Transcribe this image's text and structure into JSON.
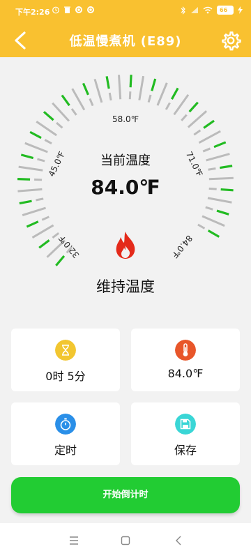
{
  "status": {
    "time": "下午2:26",
    "battery": "66",
    "icons": [
      "alarm-icon",
      "trash-icon",
      "sync-icon",
      "sync-icon"
    ]
  },
  "header": {
    "title": "低温慢煮机 (E89)",
    "back_icon": "chevron-left-icon",
    "settings_icon": "gear-icon",
    "background": "#f9c130"
  },
  "dial": {
    "scale_labels": [
      "32.0℉",
      "45.0℉",
      "58.0℉",
      "71.0℉",
      "84.0℉"
    ],
    "current_label": "当前温度",
    "current_value": "84.0℉",
    "mode_label": "维持温度",
    "active_color": "#22bb22",
    "inactive_color": "#bbbbbb"
  },
  "cards": {
    "timer": {
      "label": "0时 5分",
      "icon": "hourglass-icon",
      "color": "#f2c630"
    },
    "temperature": {
      "label": "84.0℉",
      "icon": "thermometer-icon",
      "color": "#e8562a"
    },
    "schedule": {
      "label": "定时",
      "icon": "stopwatch-icon",
      "color": "#2a8fe8"
    },
    "save": {
      "label": "保存",
      "icon": "floppy-disk-icon",
      "color": "#3ad6d6"
    }
  },
  "start_button": {
    "label": "开始倒计时",
    "color": "#22cc33"
  },
  "navbar": {
    "icons": [
      "menu-icon",
      "home-icon",
      "back-icon"
    ]
  }
}
